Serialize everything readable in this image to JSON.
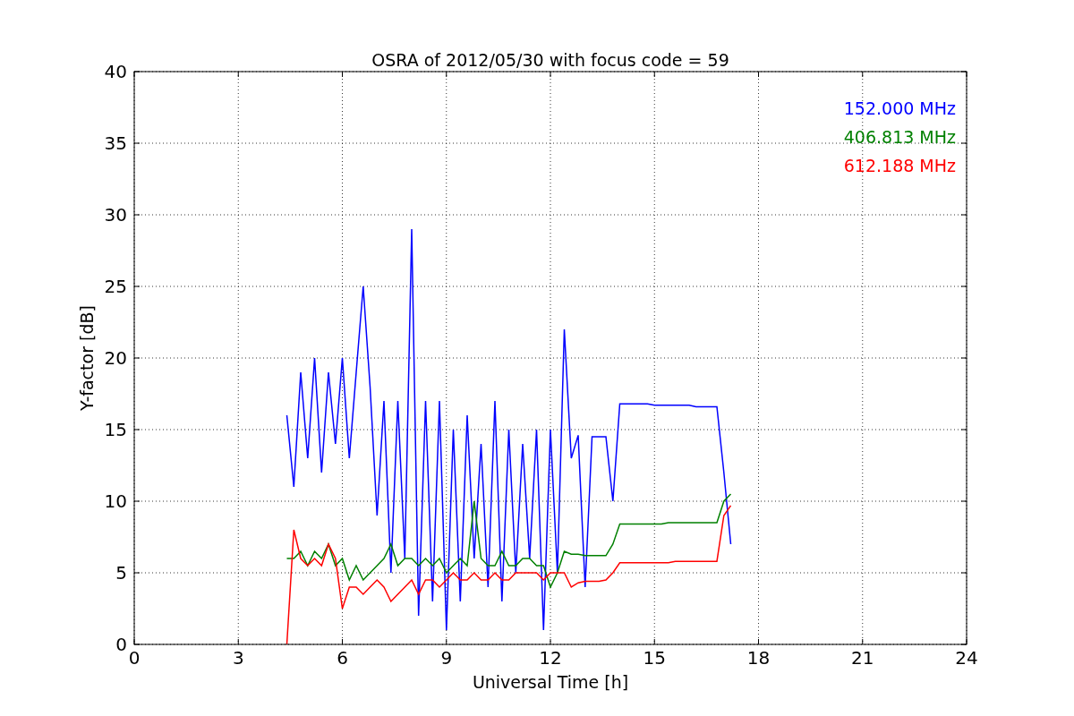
{
  "chart_data": {
    "type": "line",
    "title": "OSRA of 2012/05/30 with focus code = 59",
    "xlabel": "Universal Time [h]",
    "ylabel": "Y-factor [dB]",
    "x": [
      4.4,
      4.6,
      4.8,
      5.0,
      5.2,
      5.4,
      5.6,
      5.8,
      6.0,
      6.2,
      6.4,
      6.6,
      6.8,
      7.0,
      7.2,
      7.4,
      7.6,
      7.8,
      8.0,
      8.2,
      8.4,
      8.6,
      8.8,
      9.0,
      9.2,
      9.4,
      9.6,
      9.8,
      10.0,
      10.2,
      10.4,
      10.6,
      10.8,
      11.0,
      11.2,
      11.4,
      11.6,
      11.8,
      12.0,
      12.2,
      12.4,
      12.6,
      12.8,
      13.0,
      13.2,
      13.4,
      13.6,
      13.8,
      14.0,
      14.2,
      14.4,
      14.6,
      14.8,
      15.0,
      15.2,
      15.4,
      15.6,
      15.8,
      16.0,
      16.2,
      16.4,
      16.6,
      16.8,
      17.0,
      17.2
    ],
    "series": [
      {
        "name": "152.000 MHz",
        "color": "#0000ff",
        "values": [
          16,
          11,
          19,
          13,
          20,
          12,
          19,
          14,
          20,
          13,
          19,
          25,
          18,
          9,
          17,
          5,
          17,
          6,
          29,
          2,
          17,
          3,
          17,
          1,
          15,
          3,
          16,
          6,
          14,
          4,
          17,
          3,
          15,
          5,
          14,
          6,
          15,
          1,
          15,
          5,
          22,
          13,
          14.6,
          4,
          14.5,
          14.5,
          14.5,
          10,
          16.8,
          16.8,
          16.8,
          16.8,
          16.8,
          16.7,
          16.7,
          16.7,
          16.7,
          16.7,
          16.7,
          16.6,
          16.6,
          16.6,
          16.6,
          12,
          7
        ]
      },
      {
        "name": "406.813 MHz",
        "color": "#008000",
        "values": [
          6,
          6,
          6.5,
          5.5,
          6.5,
          6,
          7,
          5.5,
          6,
          4.5,
          5.5,
          4.5,
          5,
          5.5,
          6,
          7,
          5.5,
          6,
          6,
          5.5,
          6,
          5.5,
          6,
          5,
          5.5,
          6,
          5.5,
          10,
          6,
          5.5,
          5.5,
          6.5,
          5.5,
          5.5,
          6,
          6,
          5.5,
          5.5,
          4,
          5,
          6.5,
          6.3,
          6.3,
          6.2,
          6.2,
          6.2,
          6.2,
          7,
          8.4,
          8.4,
          8.4,
          8.4,
          8.4,
          8.4,
          8.4,
          8.5,
          8.5,
          8.5,
          8.5,
          8.5,
          8.5,
          8.5,
          8.5,
          10,
          10.5
        ]
      },
      {
        "name": "612.188 MHz",
        "color": "#ff0000",
        "values": [
          0,
          8,
          6,
          5.5,
          6,
          5.5,
          7,
          6,
          2.5,
          4,
          4,
          3.5,
          4,
          4.5,
          4,
          3,
          3.5,
          4,
          4.5,
          3.5,
          4.5,
          4.5,
          4,
          4.5,
          5,
          4.5,
          4.5,
          5,
          4.5,
          4.5,
          5,
          4.5,
          4.5,
          5,
          5,
          5,
          5,
          4.5,
          5,
          5,
          5,
          4,
          4.3,
          4.4,
          4.4,
          4.4,
          4.5,
          5,
          5.7,
          5.7,
          5.7,
          5.7,
          5.7,
          5.7,
          5.7,
          5.7,
          5.8,
          5.8,
          5.8,
          5.8,
          5.8,
          5.8,
          5.8,
          9,
          9.7
        ]
      }
    ],
    "grid": true,
    "xlim": [
      0,
      24
    ],
    "ylim": [
      0,
      40
    ],
    "xticks": [
      0,
      3,
      6,
      9,
      12,
      15,
      18,
      21,
      24
    ],
    "yticks": [
      0,
      5,
      10,
      15,
      20,
      25,
      30,
      35,
      40
    ]
  }
}
